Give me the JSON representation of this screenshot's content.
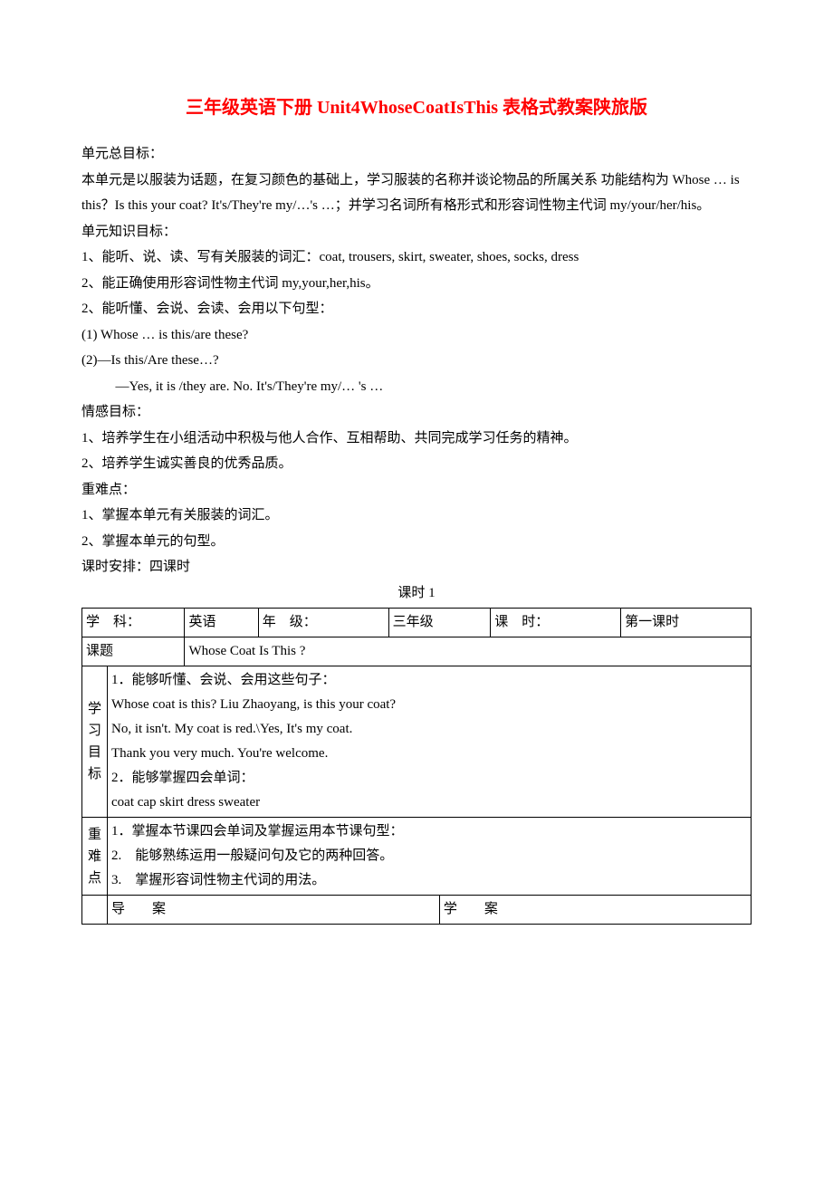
{
  "title": "三年级英语下册 Unit4WhoseCoatIsThis 表格式教案陕旅版",
  "overall_goal": {
    "label": "单元总目标：",
    "p1": "本单元是以服装为话题，在复习颜色的基础上，学习服装的名称并谈论物品的所属关系 功能结构为 Whose … is this？Is this your coat? It's/They're my/…'s …；并学习名词所有格形式和形容词性物主代词 my/your/her/his。"
  },
  "knowledge_goal": {
    "label": "单元知识目标：",
    "items": [
      "1、能听、说、读、写有关服装的词汇：coat, trousers, skirt, sweater, shoes, socks, dress",
      "2、能正确使用形容词性物主代词 my,your,her,his。",
      "2、能听懂、会说、会读、会用以下句型：",
      "(1) Whose … is this/are these?",
      "(2)—Is this/Are these…?"
    ],
    "indented": "—Yes, it is /they are. No. It's/They're my/… 's …"
  },
  "emotion_goal": {
    "label": "情感目标：",
    "items": [
      "1、培养学生在小组活动中积极与他人合作、互相帮助、共同完成学习任务的精神。",
      "2、培养学生诚实善良的优秀品质。"
    ]
  },
  "difficulties": {
    "label": "重难点：",
    "items": [
      "1、掌握本单元有关服装的词汇。",
      "2、掌握本单元的句型。"
    ]
  },
  "schedule": "课时安排：四课时",
  "lesson_caption": "课时 1",
  "table": {
    "r1": {
      "subject_label": "学　科：",
      "subject_value": "英语",
      "grade_label": "年　级：",
      "grade_value": "三年级",
      "period_label": "课　时：",
      "period_value": "第一课时"
    },
    "r2": {
      "topic_label": "课题",
      "topic_value": "  Whose Coat Is This ?"
    },
    "r3": {
      "label": "学习目标",
      "lines": [
        "1．能够听懂、会说、会用这些句子：",
        "Whose coat is this? Liu Zhaoyang, is this your coat?",
        "No, it isn't. My coat is red.\\Yes, It's my coat.",
        " Thank you very much. You're welcome.",
        "2．能够掌握四会单词：",
        "coat   cap  skirt  dress  sweater"
      ]
    },
    "r4": {
      "label": "重难点",
      "lines": [
        "1．掌握本节课四会单词及掌握运用本节课句型：",
        "2.　能够熟练运用一般疑问句及它的两种回答。",
        "3.　掌握形容词性物主代词的用法。"
      ]
    },
    "r5": {
      "col1": "导　　案",
      "col2": "学　　案"
    }
  }
}
